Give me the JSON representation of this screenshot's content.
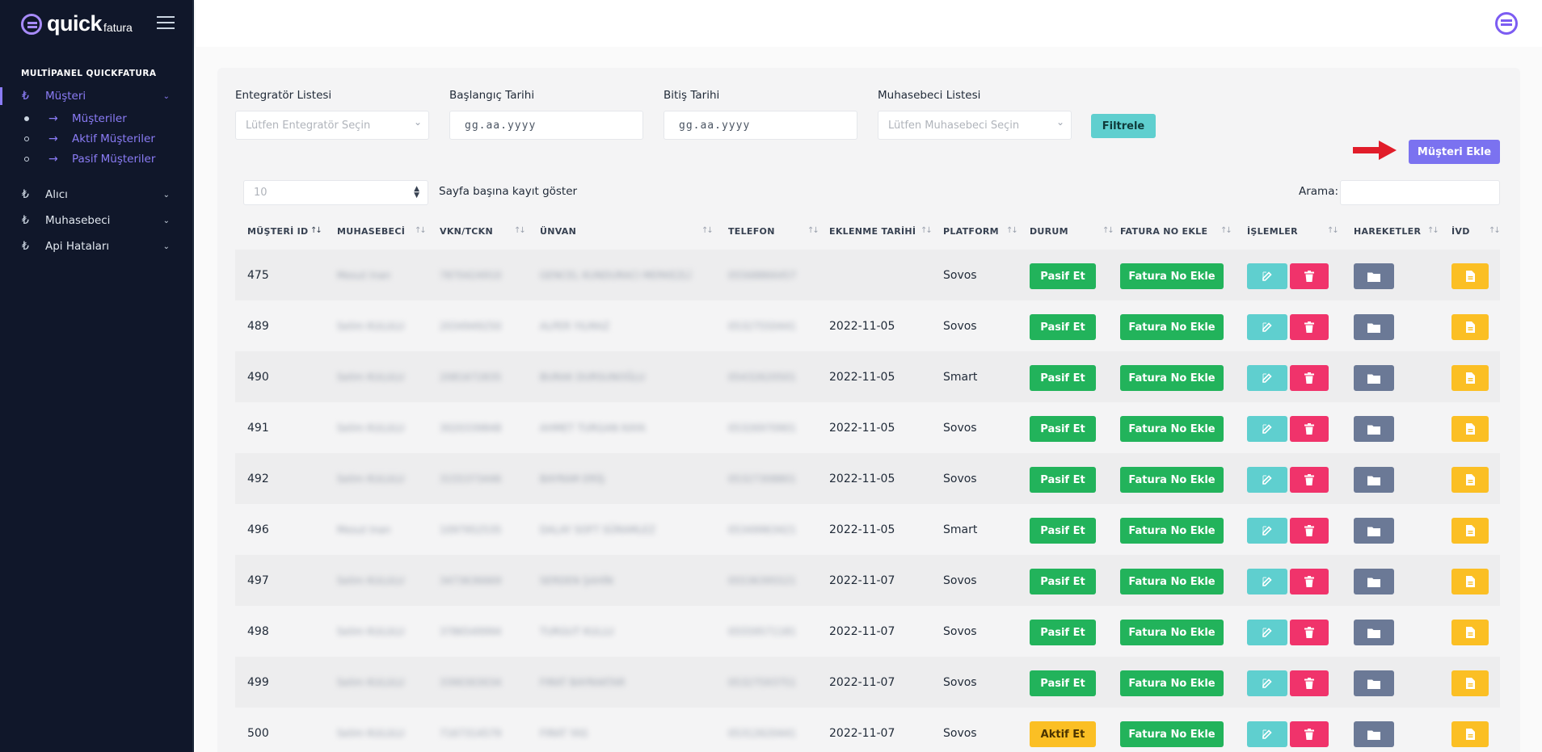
{
  "brand": {
    "name": "quick",
    "sub": "fatura"
  },
  "sidebar": {
    "section": "MULTİPANEL QUICKFATURA",
    "menu": [
      {
        "label": "Müşteri",
        "icon": "lira-icon"
      },
      {
        "label": "Alıcı",
        "icon": "lira-icon"
      },
      {
        "label": "Muhasebeci",
        "icon": "lira-icon"
      },
      {
        "label": "Api Hataları",
        "icon": "lira-icon"
      }
    ],
    "submenu": [
      {
        "label": "Müşteriler"
      },
      {
        "label": "Aktif Müşteriler"
      },
      {
        "label": "Pasif Müşteriler"
      }
    ]
  },
  "filters": {
    "integrator": {
      "label": "Entegratör Listesi",
      "placeholder": "Lütfen Entegratör Seçin"
    },
    "start_date": {
      "label": "Başlangıç Tarihi",
      "value": "gg.aa.yyyy"
    },
    "end_date": {
      "label": "Bitiş Tarihi",
      "value": "gg.aa.yyyy"
    },
    "accountant": {
      "label": "Muhasebeci Listesi",
      "placeholder": "Lütfen Muhasebeci Seçin"
    },
    "filter_button": "Filtrele"
  },
  "add_button": "Müşteri Ekle",
  "table_controls": {
    "page_size": "10",
    "page_size_label": "Sayfa başına kayıt göster",
    "search_label": "Arama:"
  },
  "table": {
    "columns": [
      "MÜŞTERİ ID",
      "MUHASEBECİ",
      "VKN/TCKN",
      "ÜNVAN",
      "TELEFON",
      "EKLENME TARİHİ",
      "PLATFORM",
      "DURUM",
      "FATURA NO EKLE",
      "İŞLEMLER",
      "HAREKETLER",
      "İVD"
    ],
    "rows": [
      {
        "id": "475",
        "muhasebeci": "Mesut Inan",
        "vkn": "7870424910",
        "unvan": "GENCEL KUNDURACI MERKEZLİ",
        "telefon": "05568866457",
        "tarih": "",
        "platform": "Sovos",
        "durum": "Pasif Et",
        "fatura": "Fatura No Ekle"
      },
      {
        "id": "489",
        "muhasebeci": "Selim KULULU",
        "vkn": "2034949250",
        "unvan": "ALPER YILMAZ",
        "telefon": "05327550441",
        "tarih": "2022-11-05",
        "platform": "Sovos",
        "durum": "Pasif Et",
        "fatura": "Fatura No Ekle"
      },
      {
        "id": "490",
        "muhasebeci": "Selim KULULU",
        "vkn": "2081672835",
        "unvan": "BURAK DURSUNOĞLU",
        "telefon": "05432620501",
        "tarih": "2022-11-05",
        "platform": "Smart",
        "durum": "Pasif Et",
        "fatura": "Fatura No Ekle"
      },
      {
        "id": "491",
        "muhasebeci": "Selim KULULU",
        "vkn": "3020339848",
        "unvan": "AHMET TURGAN KAYA",
        "telefon": "05326970901",
        "tarih": "2022-11-05",
        "platform": "Sovos",
        "durum": "Pasif Et",
        "fatura": "Fatura No Ekle"
      },
      {
        "id": "492",
        "muhasebeci": "Selim KULULU",
        "vkn": "3155373446",
        "unvan": "BAYRAM ERİŞ",
        "telefon": "05327308801",
        "tarih": "2022-11-05",
        "platform": "Sovos",
        "durum": "Pasif Et",
        "fatura": "Fatura No Ekle"
      },
      {
        "id": "496",
        "muhasebeci": "Mesut Inan",
        "vkn": "1097952535",
        "unvan": "DALAY SOFT SÜRAMLEZ",
        "telefon": "05349963421",
        "tarih": "2022-11-05",
        "platform": "Smart",
        "durum": "Pasif Et",
        "fatura": "Fatura No Ekle"
      },
      {
        "id": "497",
        "muhasebeci": "Selim KULULU",
        "vkn": "3473636669",
        "unvan": "SERDEN ŞAHİN",
        "telefon": "05536395521",
        "tarih": "2022-11-07",
        "platform": "Sovos",
        "durum": "Pasif Et",
        "fatura": "Fatura No Ekle"
      },
      {
        "id": "498",
        "muhasebeci": "Selim KULULU",
        "vkn": "3786549994",
        "unvan": "TURGUT KULLU",
        "telefon": "05559571181",
        "tarih": "2022-11-07",
        "platform": "Sovos",
        "durum": "Pasif Et",
        "fatura": "Fatura No Ekle"
      },
      {
        "id": "499",
        "muhasebeci": "Selim KULULU",
        "vkn": "3390303034",
        "unvan": "FIRAT BAYRAKTAR",
        "telefon": "05327593751",
        "tarih": "2022-11-07",
        "platform": "Sovos",
        "durum": "Pasif Et",
        "fatura": "Fatura No Ekle"
      },
      {
        "id": "500",
        "muhasebeci": "Selim KULULU",
        "vkn": "7167314579",
        "unvan": "FIRAT YAS",
        "telefon": "05312620441",
        "tarih": "2022-11-07",
        "platform": "Sovos",
        "durum": "Aktif Et",
        "fatura": "Fatura No Ekle"
      }
    ]
  },
  "colors": {
    "accent": "#7b72f0",
    "sidebar_bg": "#10172a",
    "success": "#22b35b",
    "warning": "#fbbf24",
    "danger": "#f0336b",
    "info": "#5fcfcf",
    "slate": "#6b7996"
  }
}
